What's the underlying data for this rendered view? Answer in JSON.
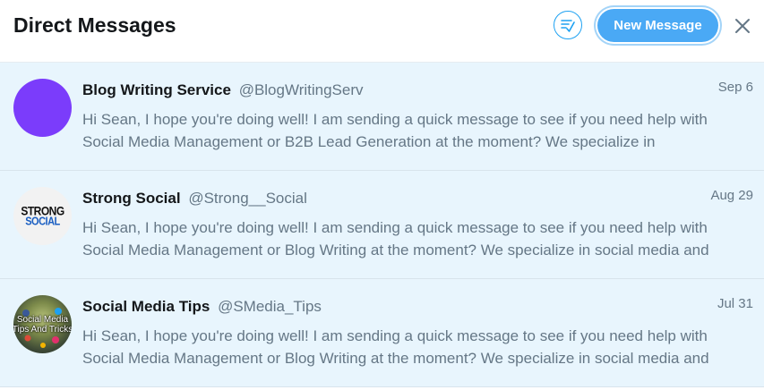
{
  "header": {
    "title": "Direct Messages",
    "new_message_label": "New Message"
  },
  "colors": {
    "accent": "#1da1f2",
    "button_bg": "#4aa9f5",
    "row_bg": "#e8f5fd"
  },
  "conversations": [
    {
      "name": "Blog Writing Service",
      "handle": "@BlogWritingServ",
      "date": "Sep 6",
      "preview_line1": "Hi Sean, I hope you're doing well! I am sending a quick message to see if you need help with",
      "preview_line2": "Social Media Management or B2B Lead Generation at the moment? We specialize in",
      "avatar": "purple-circle-avatar"
    },
    {
      "name": "Strong Social",
      "handle": "@Strong__Social",
      "date": "Aug 29",
      "preview_line1": "Hi Sean, I hope you're doing well! I am sending a quick message to see if you need help with",
      "preview_line2": "Social Media Management or Blog Writing at the moment? We specialize in social media and",
      "avatar_text_1": "STRONG",
      "avatar_text_2": "SOCIAL"
    },
    {
      "name": "Social Media Tips",
      "handle": "@SMedia_Tips",
      "date": "Jul 31",
      "preview_line1": "Hi Sean, I hope you're doing well! I am sending a quick message to see if you need help with",
      "preview_line2": "Social Media Management or Blog Writing at the moment? We specialize in social media and",
      "avatar_text_1": "Social Media",
      "avatar_text_2": "Tips And Tricks"
    }
  ]
}
